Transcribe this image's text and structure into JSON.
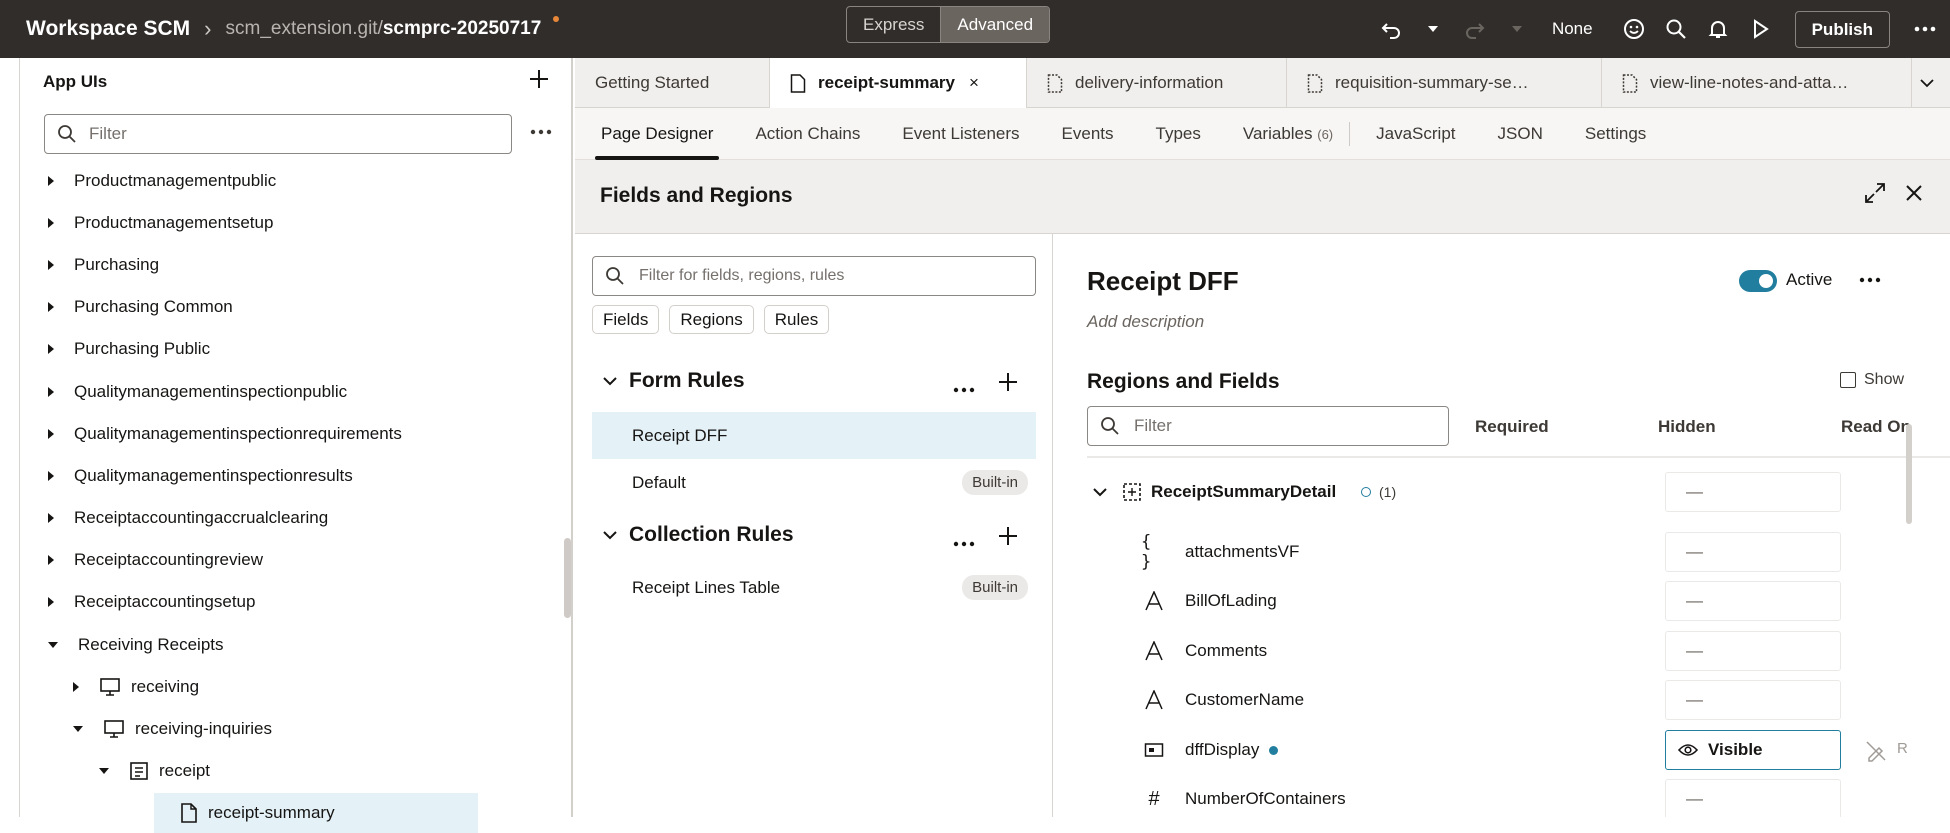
{
  "topbar": {
    "workspace": "Workspace SCM",
    "path": "scm_extension.git/",
    "branch": "scmprc-20250717",
    "mode_express": "Express",
    "mode_advanced": "Advanced",
    "none_label": "None",
    "publish": "Publish"
  },
  "nav": {
    "title": "App UIs",
    "filter_placeholder": "Filter",
    "items": [
      {
        "label": "Productmanagementpublic",
        "level": 0,
        "state": "closed"
      },
      {
        "label": "Productmanagementsetup",
        "level": 0,
        "state": "closed"
      },
      {
        "label": "Purchasing",
        "level": 0,
        "state": "closed"
      },
      {
        "label": "Purchasing Common",
        "level": 0,
        "state": "closed"
      },
      {
        "label": "Purchasing Public",
        "level": 0,
        "state": "closed"
      },
      {
        "label": "Qualitymanagementinspectionpublic",
        "level": 0,
        "state": "closed"
      },
      {
        "label": "Qualitymanagementinspectionrequirements",
        "level": 0,
        "state": "closed"
      },
      {
        "label": "Qualitymanagementinspectionresults",
        "level": 0,
        "state": "closed"
      },
      {
        "label": "Receiptaccountingaccrualclearing",
        "level": 0,
        "state": "closed"
      },
      {
        "label": "Receiptaccountingreview",
        "level": 0,
        "state": "closed"
      },
      {
        "label": "Receiptaccountingsetup",
        "level": 0,
        "state": "closed"
      },
      {
        "label": "Receiving Receipts",
        "level": 0,
        "state": "open"
      },
      {
        "label": "receiving",
        "level": 1,
        "state": "closed"
      },
      {
        "label": "receiving-inquiries",
        "level": 1,
        "state": "open"
      },
      {
        "label": "receipt",
        "level": 2,
        "state": "open"
      },
      {
        "label": "receipt-summary",
        "level": 3,
        "state": "leaf"
      }
    ]
  },
  "tabs": [
    {
      "label": "Getting Started"
    },
    {
      "label": "receipt-summary",
      "active": true
    },
    {
      "label": "delivery-information"
    },
    {
      "label": "requisition-summary-se…"
    },
    {
      "label": "view-line-notes-and-atta…"
    }
  ],
  "subtabs": {
    "page_designer": "Page Designer",
    "action_chains": "Action Chains",
    "event_listeners": "Event Listeners",
    "events": "Events",
    "types": "Types",
    "variables": "Variables",
    "variables_count": "(6)",
    "javascript": "JavaScript",
    "json": "JSON",
    "settings": "Settings"
  },
  "panel": {
    "title": "Fields and Regions"
  },
  "rules": {
    "filter_placeholder": "Filter for fields, regions, rules",
    "chips": [
      "Fields",
      "Regions",
      "Rules"
    ],
    "form_rules_title": "Form Rules",
    "form_rules": [
      {
        "label": "Receipt DFF",
        "badge": ""
      },
      {
        "label": "Default",
        "badge": "Built-in"
      }
    ],
    "collection_rules_title": "Collection Rules",
    "collection_rules": [
      {
        "label": "Receipt Lines Table",
        "badge": "Built-in"
      }
    ]
  },
  "detail": {
    "title": "Receipt DFF",
    "description": "Add description",
    "active_label": "Active",
    "regions_title": "Regions and Fields",
    "show_label": "Show",
    "filter_placeholder": "Filter",
    "col_required": "Required",
    "col_hidden": "Hidden",
    "col_readonly": "Read On",
    "region": {
      "name": "ReceiptSummaryDetail",
      "count": "(1)"
    },
    "dash": "—",
    "visible_label": "Visible",
    "fields": [
      {
        "name": "attachmentsVF",
        "icon": "braces-icon",
        "hidden": "—"
      },
      {
        "name": "BillOfLading",
        "icon": "text-icon",
        "hidden": "—"
      },
      {
        "name": "Comments",
        "icon": "text-icon",
        "hidden": "—"
      },
      {
        "name": "CustomerName",
        "icon": "text-icon",
        "hidden": "—"
      },
      {
        "name": "dffDisplay",
        "icon": "display-icon",
        "hidden": "Visible"
      },
      {
        "name": "NumberOfContainers",
        "icon": "number-icon",
        "hidden": "—"
      }
    ]
  }
}
